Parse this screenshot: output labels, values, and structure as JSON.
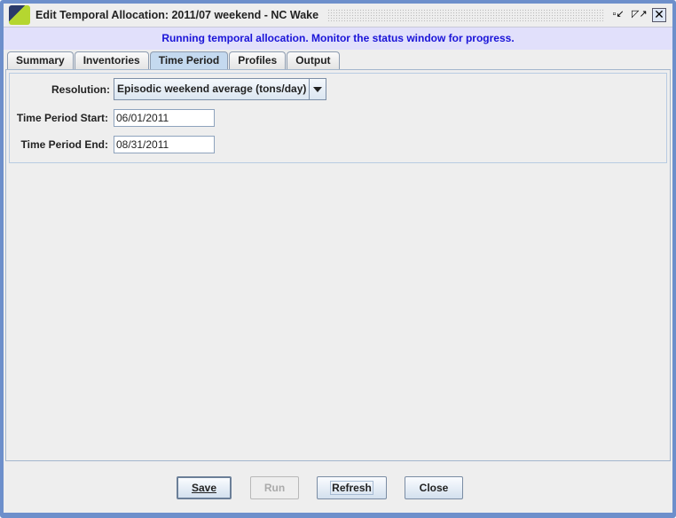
{
  "window": {
    "title": "Edit Temporal Allocation: 2011/07 weekend - NC Wake",
    "icon": "emf-app-icon"
  },
  "status_message": "Running temporal allocation. Monitor the status window for progress.",
  "tabs": [
    {
      "label": "Summary"
    },
    {
      "label": "Inventories"
    },
    {
      "label": "Time Period",
      "active": true
    },
    {
      "label": "Profiles"
    },
    {
      "label": "Output"
    }
  ],
  "form": {
    "resolution_label": "Resolution:",
    "resolution_value": "Episodic weekend average (tons/day)",
    "start_label": "Time Period Start:",
    "start_value": "06/01/2011",
    "end_label": "Time Period End:",
    "end_value": "08/31/2011"
  },
  "buttons": {
    "save": "Save",
    "run": "Run",
    "refresh": "Refresh",
    "close": "Close"
  },
  "colors": {
    "message_bg": "#e1e0fb",
    "message_text": "#1a14d8",
    "active_tab": "#c4d9ef",
    "window_border": "#6d8fcb"
  }
}
